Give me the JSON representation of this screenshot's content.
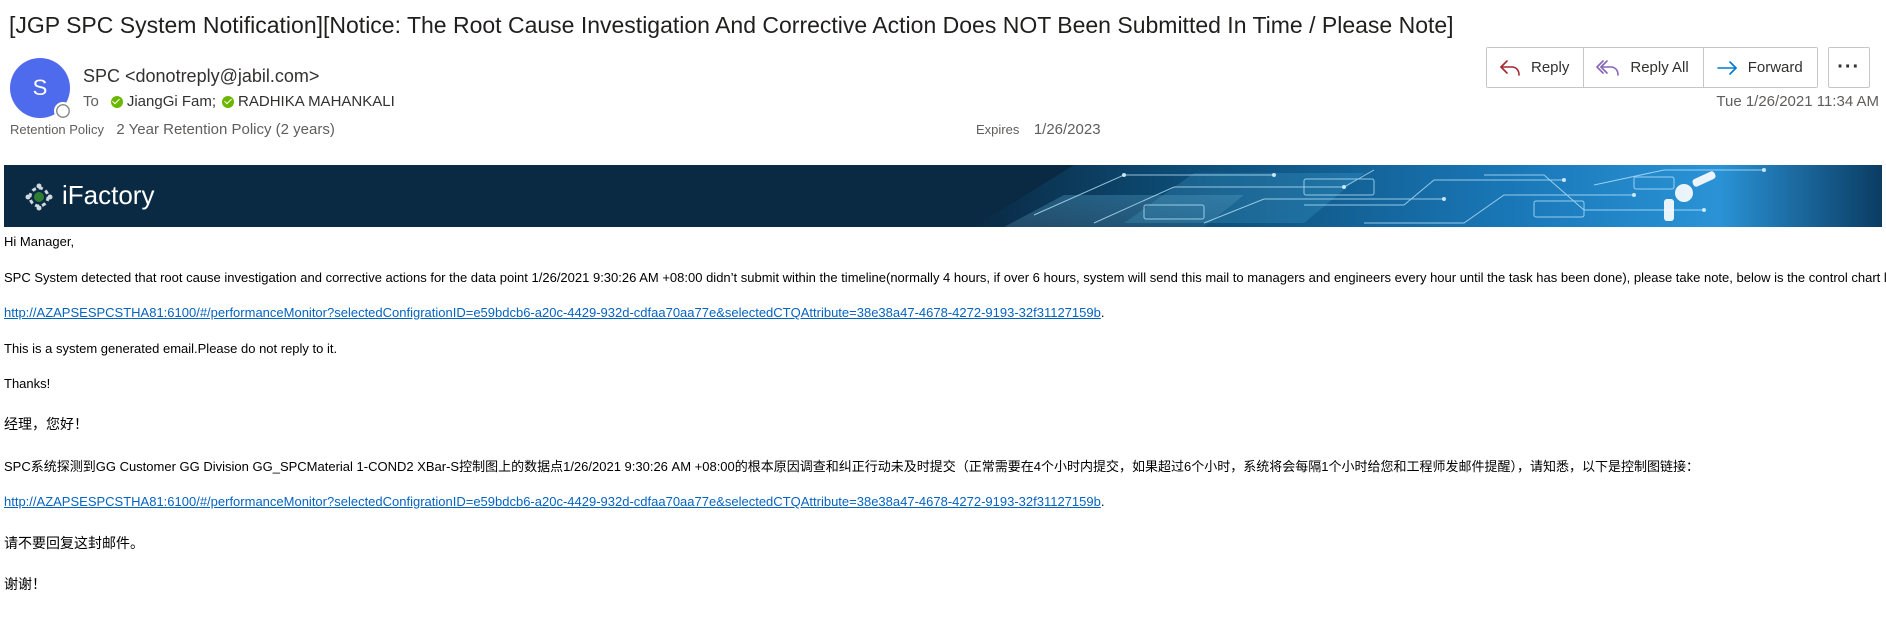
{
  "email": {
    "subject": "[JGP SPC System Notification][Notice: The Root Cause Investigation And Corrective Action Does NOT Been Submitted In Time / Please Note]",
    "avatar_initial": "S",
    "sender": "SPC <donotreply@jabil.com>",
    "to_label": "To",
    "recipients": [
      "JiangGi Fam;",
      "RADHIKA MAHANKALI"
    ],
    "retention_label": "Retention Policy",
    "retention_value": "2 Year Retention Policy (2 years)",
    "expires_label": "Expires",
    "expires_value": "1/26/2023",
    "date": "Tue 1/26/2021 11:34 AM"
  },
  "actions": {
    "reply": "Reply",
    "reply_all": "Reply All",
    "forward": "Forward",
    "more": "···"
  },
  "banner": {
    "title": "iFactory"
  },
  "body": {
    "greeting_en": "Hi Manager,",
    "para_en": "SPC System detected that root cause investigation and corrective actions for the data point 1/26/2021 9:30:26 AM +08:00 didn’t submit within the timeline(normally 4 hours, if over 6 hours, system will send this mail to managers and engineers every hour until the task has been done), please take note, below is the control chart link:",
    "link_en": "http://AZAPSESPCSTHA81:6100/#/performanceMonitor?selectedConfigrationID=e59bdcb6-a20c-4429-932d-cdfaa70aa77e&selectedCTQAttribute=38e38a47-4678-4272-9193-32f31127159b",
    "link_en_suffix": ".",
    "system_en": "This is a system generated email.Please do not reply to it.",
    "thanks_en": "Thanks!",
    "greeting_cn": "经理，您好！",
    "para_cn": "SPC系统探测到GG Customer GG Division GG_SPCMaterial 1-COND2 XBar-S控制图上的数据点1/26/2021 9:30:26 AM +08:00的根本原因调查和纠正行动未及时提交（正常需要在4个小时内提交，如果超过6个小时，系统将会每隔1个小时给您和工程师发邮件提醒），请知悉，以下是控制图链接：",
    "link_cn": "http://AZAPSESPCSTHA81:6100/#/performanceMonitor?selectedConfigrationID=e59bdcb6-a20c-4429-932d-cdfaa70aa77e&selectedCTQAttribute=38e38a47-4678-4272-9193-32f31127159b",
    "link_cn_suffix": ".",
    "system_cn": "请不要回复这封邮件。",
    "thanks_cn": "谢谢！"
  },
  "colors": {
    "avatar": "#4f6bed",
    "banner_bg": "#0a2a44",
    "link": "#0563c1",
    "presence_ok": "#6bb700",
    "reply_icon": "#a4262c",
    "reply_all_icon": "#8764b8",
    "forward_icon": "#0078d4"
  },
  "icons": {
    "reply": "reply-arrow-icon",
    "reply_all": "reply-all-arrow-icon",
    "forward": "forward-arrow-icon",
    "more": "more-options-icon",
    "presence": "presence-status-icon",
    "recipient_status": "available-check-icon",
    "banner_logo": "ifactory-gear-logo-icon"
  }
}
